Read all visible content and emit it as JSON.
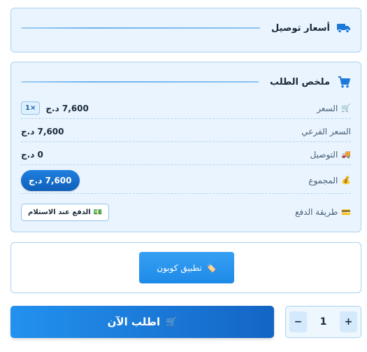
{
  "shipping": {
    "title": "أسعار توصيل",
    "icon": "truck-icon"
  },
  "summary": {
    "title": "ملخص الطلب",
    "icon": "cart-icon",
    "rows": [
      {
        "label": "السعر",
        "emoji": "🛒",
        "value": "7,600 د.ج",
        "badge": "×1"
      },
      {
        "label": "السعر الفرعي",
        "emoji": "",
        "value": "7,600 د.ج"
      },
      {
        "label": "التوصيل",
        "emoji": "🚚",
        "value": "0 د.ج"
      },
      {
        "label": "المجموع",
        "emoji": "💰",
        "value": "7,600 د.ج"
      },
      {
        "label": "طريقة الدفع",
        "emoji": "💳",
        "value": "الدفع عند الاستلام",
        "value_emoji": "💵"
      }
    ]
  },
  "coupon": {
    "label": "تطبيق كوبون",
    "emoji": "🏷️"
  },
  "order": {
    "label": "اطلب الآن",
    "emoji": "🛒"
  },
  "quantity": {
    "value": "1",
    "minus": "−",
    "plus": "+"
  },
  "colors": {
    "accent": "#1c79d9",
    "card_bg": "#e9f4fe",
    "border": "#a9d2f3"
  }
}
